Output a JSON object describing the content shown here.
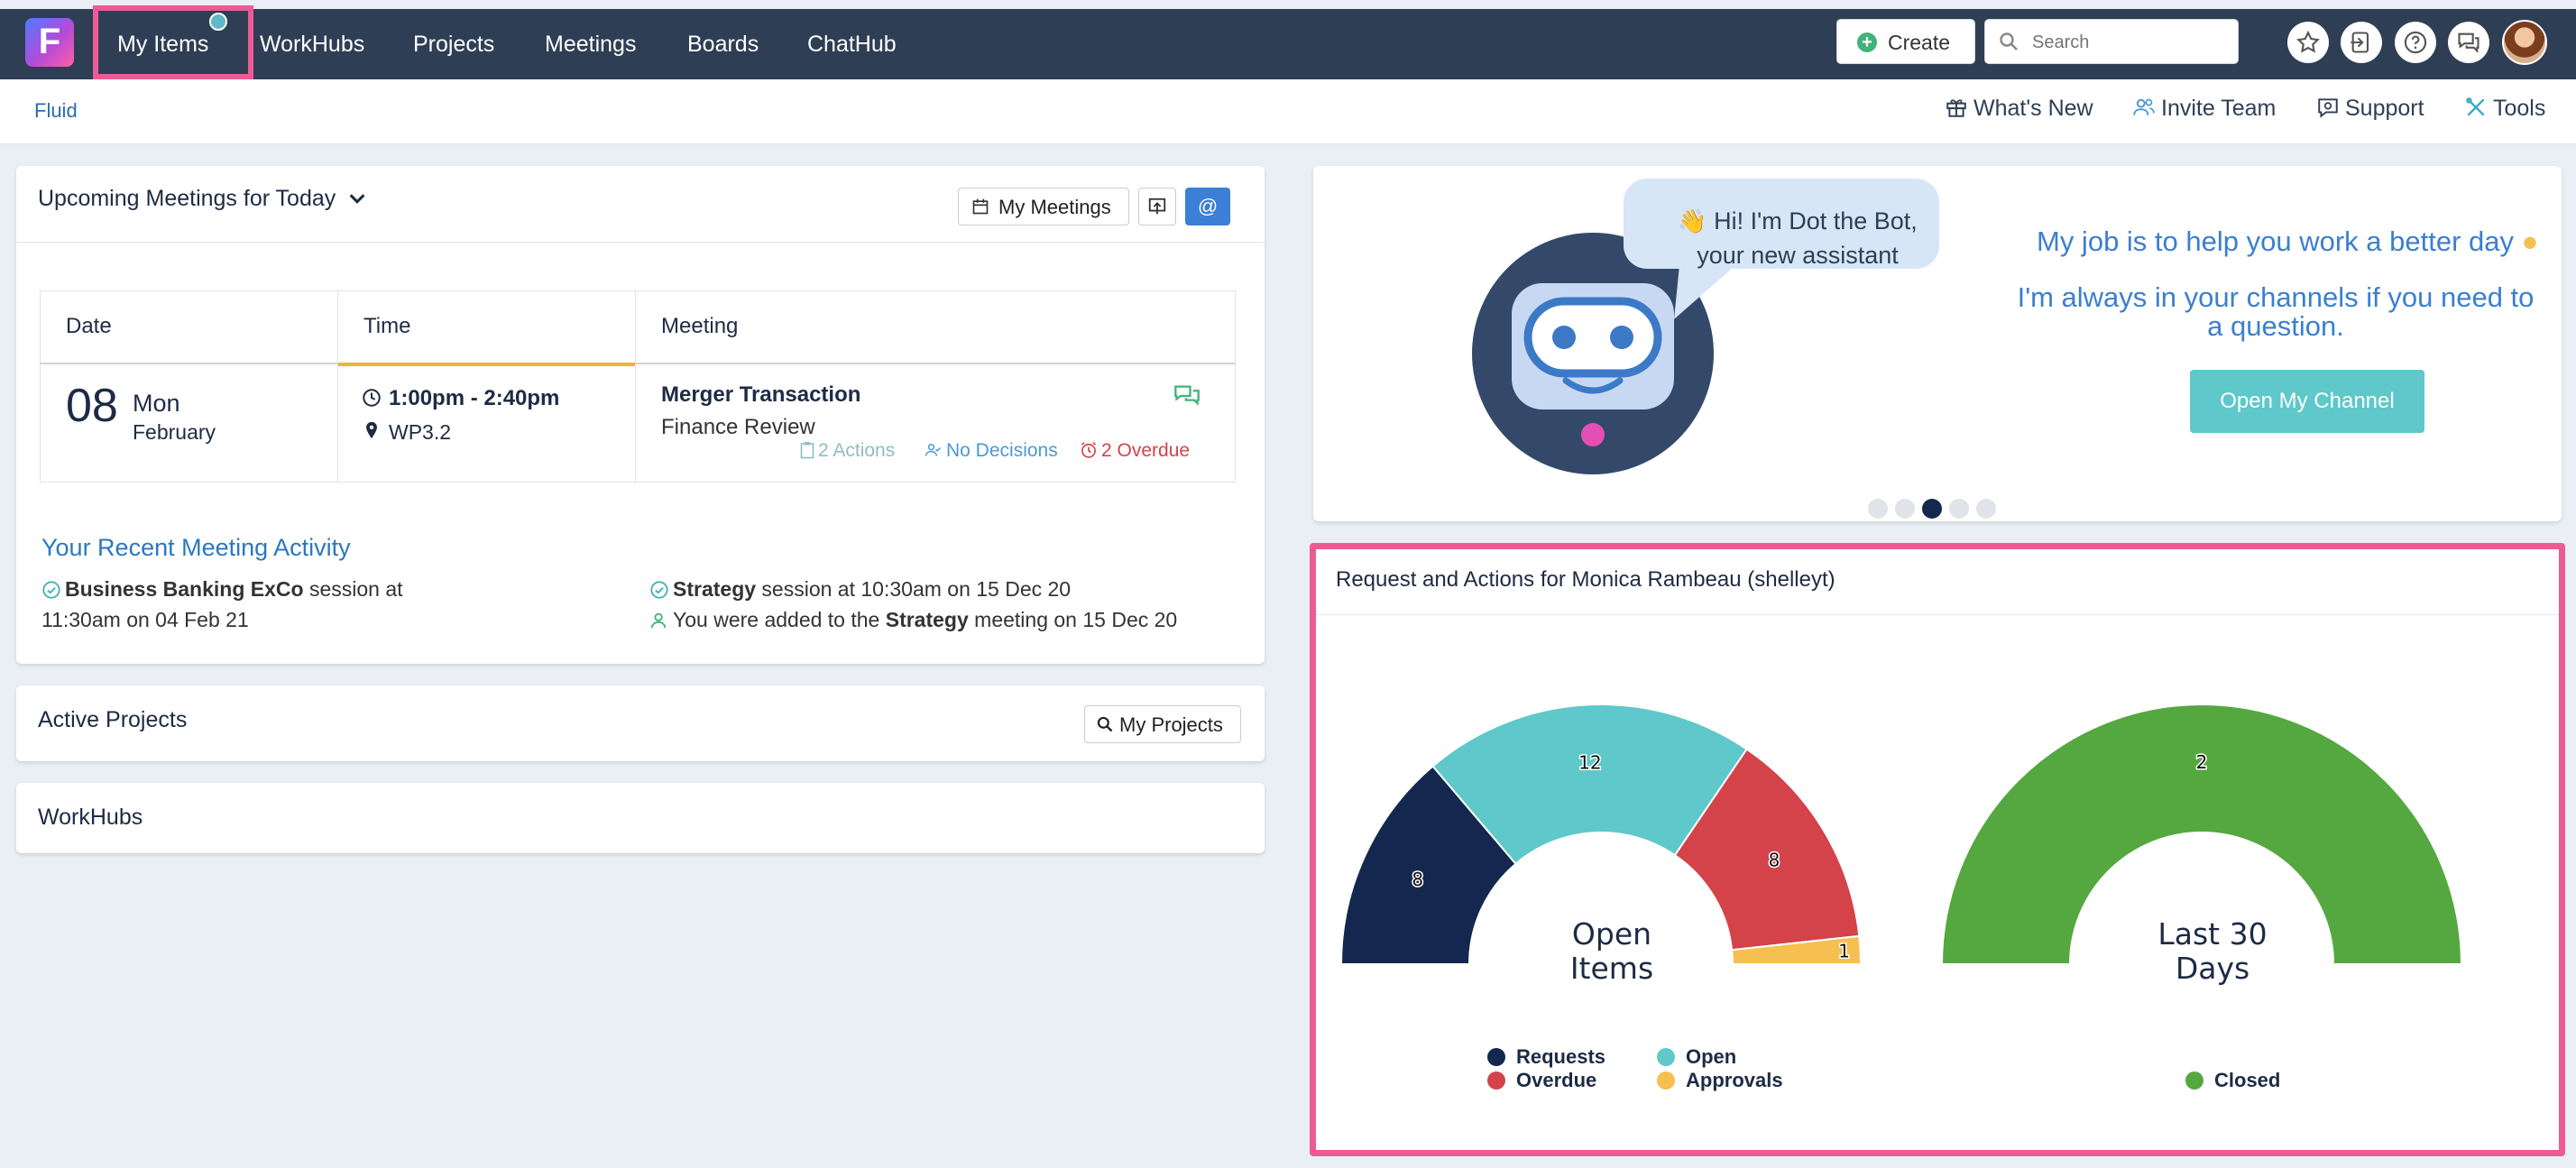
{
  "nav": {
    "logo_letter": "F",
    "items": [
      "My Items",
      "WorkHubs",
      "Projects",
      "Meetings",
      "Boards",
      "ChatHub"
    ],
    "create_label": "Create",
    "search_placeholder": "Search"
  },
  "subbar": {
    "brand": "Fluid",
    "links": [
      "What's New",
      "Invite Team",
      "Support",
      "Tools"
    ]
  },
  "meetings": {
    "title": "Upcoming Meetings for Today",
    "my_meetings_label": "My Meetings",
    "at_label": "@",
    "columns": [
      "Date",
      "Time",
      "Meeting"
    ],
    "row": {
      "day": "08",
      "weekday": "Mon",
      "month": "February",
      "time": "1:00pm - 2:40pm",
      "location": "WP3.2",
      "meeting_name": "Merger Transaction",
      "meeting_sub": "Finance Review",
      "actions": "2 Actions",
      "decisions": "No Decisions",
      "overdue": "2 Overdue"
    },
    "activity_title": "Your Recent Meeting Activity",
    "activity": [
      {
        "bold": "Business Banking ExCo",
        "rest": " session at",
        "line2": "11:30am on 04 Feb 21"
      },
      {
        "bold": "Strategy",
        "rest": " session at 10:30am on 15 Dec 20"
      },
      {
        "pre": "You were added to the ",
        "bold": "Strategy",
        "rest": " meeting on 15 Dec 20"
      }
    ]
  },
  "projects": {
    "title": "Active Projects",
    "button": "My Projects"
  },
  "workhubs": {
    "title": "WorkHubs"
  },
  "bot": {
    "bubble_line1": "Hi! I'm Dot the Bot,",
    "bubble_line2": "your new assistant",
    "headline": "My job is to help you work a better day",
    "sub_line1": "I'm always in your channels if you need to",
    "sub_line2": "a question.",
    "button": "Open My Channel"
  },
  "requests": {
    "title": "Request and Actions for Monica Rambeau (shelleyt)"
  },
  "colors": {
    "navy": "#14284f",
    "teal": "#5ec8ca",
    "red": "#d4424a",
    "amber": "#f5c050",
    "green": "#55a83f",
    "accent_pink": "#ec5b93"
  },
  "chart_data": [
    {
      "type": "pie",
      "variant": "half-donut",
      "center_label_line1": "Open",
      "center_label_line2": "Items",
      "categories": [
        "Requests",
        "Open",
        "Overdue",
        "Approvals"
      ],
      "values": [
        8,
        12,
        8,
        1
      ],
      "colors": [
        "#14284f",
        "#5ec8ca",
        "#d4424a",
        "#f5c050"
      ],
      "legend": "bottom"
    },
    {
      "type": "pie",
      "variant": "half-donut",
      "center_label_line1": "Last 30",
      "center_label_line2": "Days",
      "categories": [
        "Closed"
      ],
      "values": [
        2
      ],
      "colors": [
        "#55a83f"
      ],
      "legend": "bottom"
    }
  ]
}
